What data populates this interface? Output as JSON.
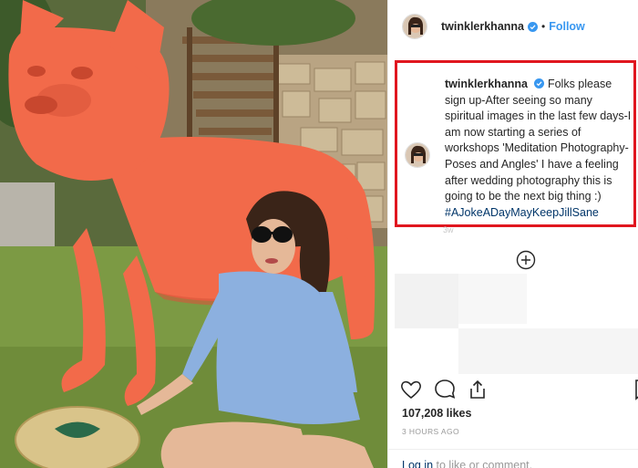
{
  "post": {
    "username": "twinklerkhanna",
    "follow_label": "Follow",
    "separator": "•",
    "verified_icon": "verified-badge-icon"
  },
  "caption": {
    "username": "twinklerkhanna",
    "text": "Folks please sign up-After seeing so many spiritual images in the last few days-I am now starting a series of workshops 'Meditation Photography-Poses and Angles' I have a feeling after wedding photography this is going to be the next big thing :)",
    "hashtag": "#AJokeADayMayKeepJillSane",
    "time_peek": "3w",
    "highlight_color": "#e0161f"
  },
  "load_more_icon": "plus-circle-icon",
  "actions": {
    "like_icon": "heart-icon",
    "comment_icon": "comment-bubble-icon",
    "share_icon": "share-icon",
    "save_icon": "bookmark-icon"
  },
  "stats": {
    "likes": "107,208 likes",
    "time": "3 HOURS AGO"
  },
  "comment_bar": {
    "login": "Log in",
    "rest": " to like or comment."
  },
  "colors": {
    "link": "#3897f0",
    "hashtag": "#003569",
    "statue": "#f26a4a"
  }
}
